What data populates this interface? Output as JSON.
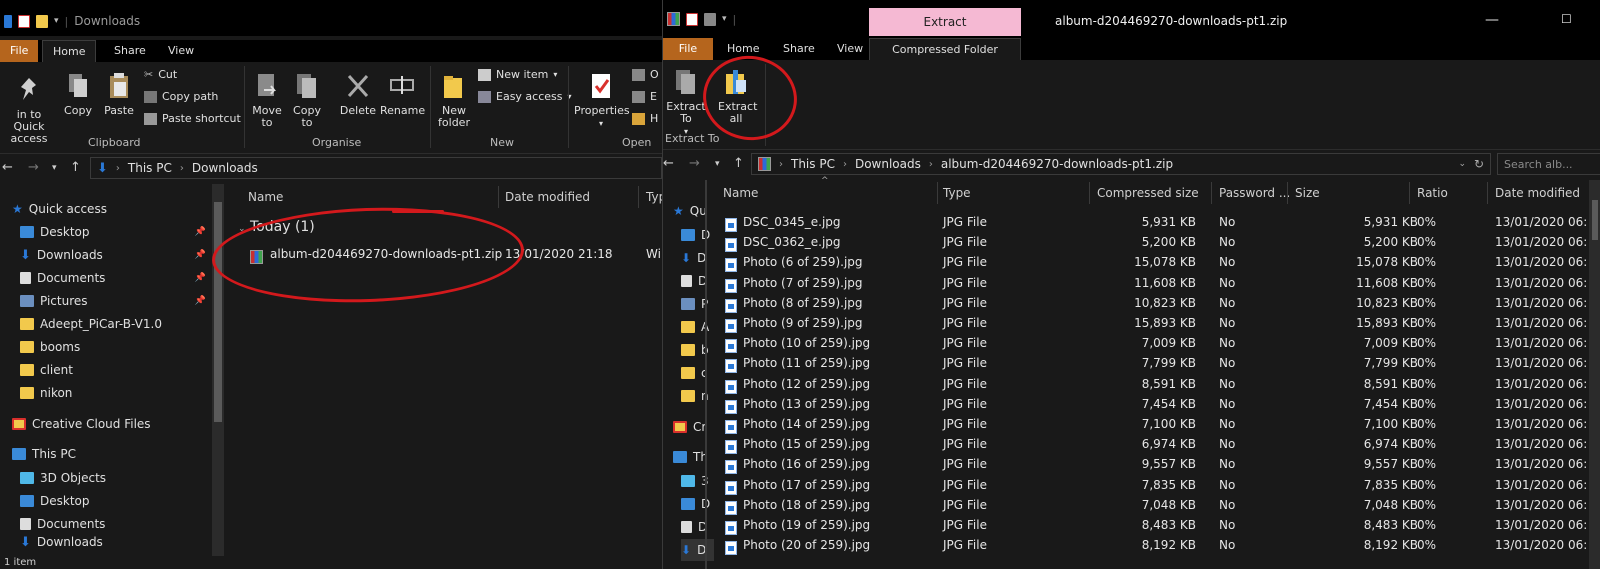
{
  "left_window": {
    "title": "Downloads",
    "tabs": {
      "file": "File",
      "home": "Home",
      "share": "Share",
      "view": "View"
    },
    "ribbon": {
      "pin_label": "in to Quick access",
      "copy": "Copy",
      "paste": "Paste",
      "cut": "Cut",
      "copy_path": "Copy path",
      "paste_shortcut": "Paste shortcut",
      "clipboard_group": "Clipboard",
      "move_to": "Move to",
      "copy_to": "Copy to",
      "delete": "Delete",
      "rename": "Rename",
      "organise_group": "Organise",
      "new_folder": "New folder",
      "new_item": "New item",
      "easy_access": "Easy access",
      "new_group": "New",
      "properties": "Properties",
      "open_group": "Open",
      "open_small_1": "O",
      "open_small_2": "E",
      "open_small_3": "H"
    },
    "address": {
      "root": "This PC",
      "folder": "Downloads"
    },
    "nav": {
      "quick_access": "Quick access",
      "desktop": "Desktop",
      "downloads": "Downloads",
      "documents": "Documents",
      "pictures": "Pictures",
      "folder1": "Adeept_PiCar-B-V1.0",
      "folder2": "booms",
      "folder3": "client",
      "folder4": "nikon",
      "creative_cloud": "Creative Cloud Files",
      "this_pc": "This PC",
      "objects3d": "3D Objects",
      "pc_desktop": "Desktop",
      "pc_documents": "Documents",
      "pc_downloads": "Downloads"
    },
    "columns": {
      "name": "Name",
      "date": "Date modified",
      "type": "Typ"
    },
    "group_header": "Today (1)",
    "file": {
      "name": "album-d204469270-downloads-pt1.zip",
      "date": "13/01/2020 21:18",
      "type": "Wi"
    },
    "status": "1 item"
  },
  "right_window": {
    "title": "album-d204469270-downloads-pt1.zip",
    "context_tab": "Extract",
    "tabs": {
      "file": "File",
      "home": "Home",
      "share": "Share",
      "view": "View",
      "tools": "Compressed Folder Tools"
    },
    "ribbon": {
      "extract_to": "Extract To",
      "extract_all": "Extract all",
      "group": "Extract To"
    },
    "address": {
      "root": "This PC",
      "folder": "Downloads",
      "zip": "album-d204469270-downloads-pt1.zip"
    },
    "search_placeholder": "Search alb...",
    "nav_fragments": [
      "Qu",
      "D",
      "D",
      "D",
      "P",
      "A",
      "b",
      "c",
      "n",
      "Cr",
      "Th",
      "3",
      "D",
      "D",
      "D"
    ],
    "columns": {
      "name": "Name",
      "type": "Type",
      "compressed": "Compressed size",
      "password": "Password ...",
      "size": "Size",
      "ratio": "Ratio",
      "date": "Date modified"
    },
    "files": [
      {
        "name": "DSC_0345_e.jpg",
        "type": "JPG File",
        "compressed": "5,931 KB",
        "password": "No",
        "size": "5,931 KB",
        "ratio": "0%",
        "date": "13/01/2020 06:"
      },
      {
        "name": "DSC_0362_e.jpg",
        "type": "JPG File",
        "compressed": "5,200 KB",
        "password": "No",
        "size": "5,200 KB",
        "ratio": "0%",
        "date": "13/01/2020 06:"
      },
      {
        "name": "Photo (6 of 259).jpg",
        "type": "JPG File",
        "compressed": "15,078 KB",
        "password": "No",
        "size": "15,078 KB",
        "ratio": "0%",
        "date": "13/01/2020 06:"
      },
      {
        "name": "Photo (7 of 259).jpg",
        "type": "JPG File",
        "compressed": "11,608 KB",
        "password": "No",
        "size": "11,608 KB",
        "ratio": "0%",
        "date": "13/01/2020 06:"
      },
      {
        "name": "Photo (8 of 259).jpg",
        "type": "JPG File",
        "compressed": "10,823 KB",
        "password": "No",
        "size": "10,823 KB",
        "ratio": "0%",
        "date": "13/01/2020 06:"
      },
      {
        "name": "Photo (9 of 259).jpg",
        "type": "JPG File",
        "compressed": "15,893 KB",
        "password": "No",
        "size": "15,893 KB",
        "ratio": "0%",
        "date": "13/01/2020 06:"
      },
      {
        "name": "Photo (10 of 259).jpg",
        "type": "JPG File",
        "compressed": "7,009 KB",
        "password": "No",
        "size": "7,009 KB",
        "ratio": "0%",
        "date": "13/01/2020 06:"
      },
      {
        "name": "Photo (11 of 259).jpg",
        "type": "JPG File",
        "compressed": "7,799 KB",
        "password": "No",
        "size": "7,799 KB",
        "ratio": "0%",
        "date": "13/01/2020 06:"
      },
      {
        "name": "Photo (12 of 259).jpg",
        "type": "JPG File",
        "compressed": "8,591 KB",
        "password": "No",
        "size": "8,591 KB",
        "ratio": "0%",
        "date": "13/01/2020 06:"
      },
      {
        "name": "Photo (13 of 259).jpg",
        "type": "JPG File",
        "compressed": "7,454 KB",
        "password": "No",
        "size": "7,454 KB",
        "ratio": "0%",
        "date": "13/01/2020 06:"
      },
      {
        "name": "Photo (14 of 259).jpg",
        "type": "JPG File",
        "compressed": "7,100 KB",
        "password": "No",
        "size": "7,100 KB",
        "ratio": "0%",
        "date": "13/01/2020 06:"
      },
      {
        "name": "Photo (15 of 259).jpg",
        "type": "JPG File",
        "compressed": "6,974 KB",
        "password": "No",
        "size": "6,974 KB",
        "ratio": "0%",
        "date": "13/01/2020 06:"
      },
      {
        "name": "Photo (16 of 259).jpg",
        "type": "JPG File",
        "compressed": "9,557 KB",
        "password": "No",
        "size": "9,557 KB",
        "ratio": "0%",
        "date": "13/01/2020 06:"
      },
      {
        "name": "Photo (17 of 259).jpg",
        "type": "JPG File",
        "compressed": "7,835 KB",
        "password": "No",
        "size": "7,835 KB",
        "ratio": "0%",
        "date": "13/01/2020 06:"
      },
      {
        "name": "Photo (18 of 259).jpg",
        "type": "JPG File",
        "compressed": "7,048 KB",
        "password": "No",
        "size": "7,048 KB",
        "ratio": "0%",
        "date": "13/01/2020 06:"
      },
      {
        "name": "Photo (19 of 259).jpg",
        "type": "JPG File",
        "compressed": "8,483 KB",
        "password": "No",
        "size": "8,483 KB",
        "ratio": "0%",
        "date": "13/01/2020 06:"
      },
      {
        "name": "Photo (20 of 259).jpg",
        "type": "JPG File",
        "compressed": "8,192 KB",
        "password": "No",
        "size": "8,192 KB",
        "ratio": "0%",
        "date": "13/01/2020 06:"
      }
    ]
  },
  "colors": {
    "file_tab": "#b5651d",
    "extract_tab": "#f5b9d3",
    "annotation": "#d3191c",
    "folder": "#f2c94c",
    "accent_blue": "#2a78d6"
  }
}
